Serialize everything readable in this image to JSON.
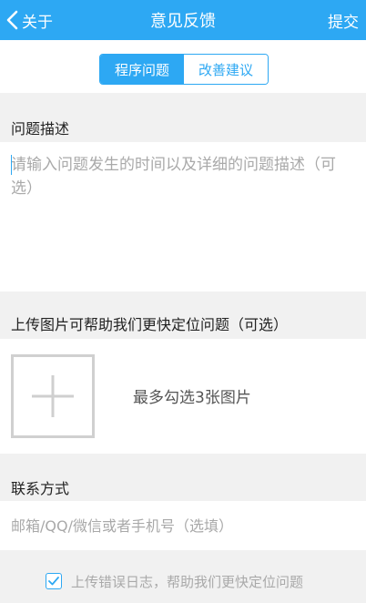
{
  "navbar": {
    "back_label": "关于",
    "title": "意见反馈",
    "submit_label": "提交"
  },
  "segment": {
    "tabs": [
      {
        "label": "程序问题",
        "active": true
      },
      {
        "label": "改善建议",
        "active": false
      }
    ]
  },
  "description": {
    "label": "问题描述",
    "placeholder": "请输入问题发生的时间以及详细的问题描述（可选）"
  },
  "images": {
    "label": "上传图片可帮助我们更快定位问题（可选）",
    "hint": "最多勾选3张图片"
  },
  "contact": {
    "label": "联系方式",
    "placeholder": "邮箱/QQ/微信或者手机号（选填）"
  },
  "log_upload": {
    "checked": true,
    "label": "上传错误日志，帮助我们更快定位问题"
  },
  "colors": {
    "accent": "#2da8f3",
    "background": "#f1f1f1",
    "placeholder": "#a9a9a9"
  }
}
